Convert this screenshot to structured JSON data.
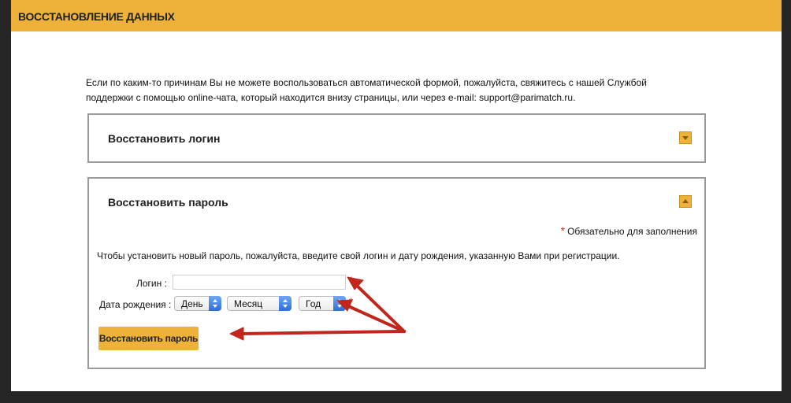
{
  "header": {
    "title": "ВОССТАНОВЛЕНИЕ ДАННЫХ"
  },
  "intro": {
    "text": "Если по каким-то причинам Вы не можете воспользоваться автоматической формой, пожалуйста, свяжитесь с нашей Службой поддержки с помощью online-чата, который находится внизу страницы, или через e-mail: support@parimatch.ru."
  },
  "login_panel": {
    "title": "Восстановить логин",
    "toggle_icon": "chevron-down-icon",
    "expanded": false
  },
  "password_panel": {
    "title": "Восстановить пароль",
    "toggle_icon": "chevron-up-icon",
    "expanded": true,
    "required_star": "*",
    "required_note": "Обязательно для заполнения",
    "instruction": "Чтобы установить новый пароль, пожалуйста, введите свой логин и дату рождения, указанную Вами при регистрации.",
    "login_label": "Логин :",
    "login_value": "",
    "dob_label": "Дата рождения :",
    "day_selected": "День",
    "month_selected": "Месяц",
    "year_selected": "Год",
    "field_required_star": "*",
    "submit_label": "Восстановить пароль"
  },
  "colors": {
    "accent": "#eeb23a",
    "required": "#c8372d",
    "annotation_arrow": "#c0261c",
    "page_background": "#262626"
  }
}
